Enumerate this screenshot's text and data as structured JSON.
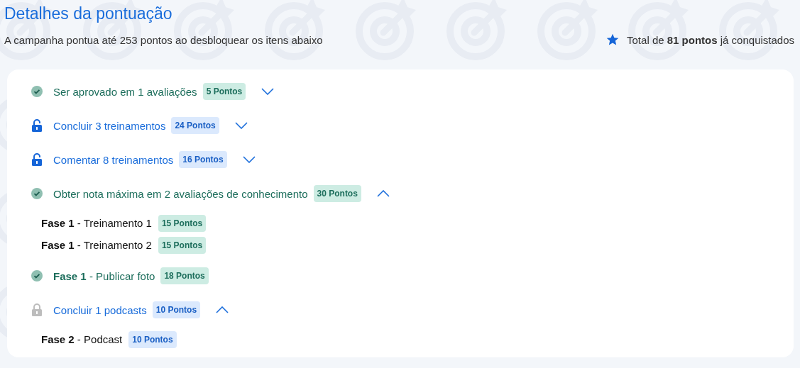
{
  "header": {
    "title": "Detalhes da pontuação",
    "subtitle": "A campanha pontua até 253 pontos ao desbloquear os itens abaixo",
    "total": "Total de **81 pontos** já conquistados"
  },
  "items": [
    {
      "label": "Ser aprovado em 1 avaliações",
      "points": "5 Pontos",
      "completed": true,
      "expanded": false
    },
    {
      "label": "Concluir 3 treinamentos",
      "points": "24 Pontos",
      "completed": false,
      "locked": false,
      "expanded": false
    },
    {
      "label": "Comentar 8 treinamentos",
      "points": "16 Pontos",
      "completed": false,
      "locked": false,
      "expanded": false
    },
    {
      "label": "Obter nota máxima em 2 avaliações de conhecimento",
      "points": "30 Pontos",
      "completed": true,
      "expanded": true,
      "children": [
        {
          "phase": "Fase 1",
          "label": "- Treinamento 1",
          "points": "15 Pontos"
        },
        {
          "phase": "Fase 1",
          "label": "- Treinamento 2",
          "points": "15 Pontos"
        }
      ]
    },
    {
      "phase": "Fase 1",
      "label": "- Publicar foto",
      "points": "18 Pontos",
      "completed": true
    },
    {
      "label": "Concluir 1 podcasts",
      "points": "10 Pontos",
      "completed": false,
      "locked": true,
      "expanded": true,
      "children": [
        {
          "phase": "Fase 2",
          "label": "- Podcast",
          "points": "10 Pontos"
        }
      ]
    }
  ]
}
